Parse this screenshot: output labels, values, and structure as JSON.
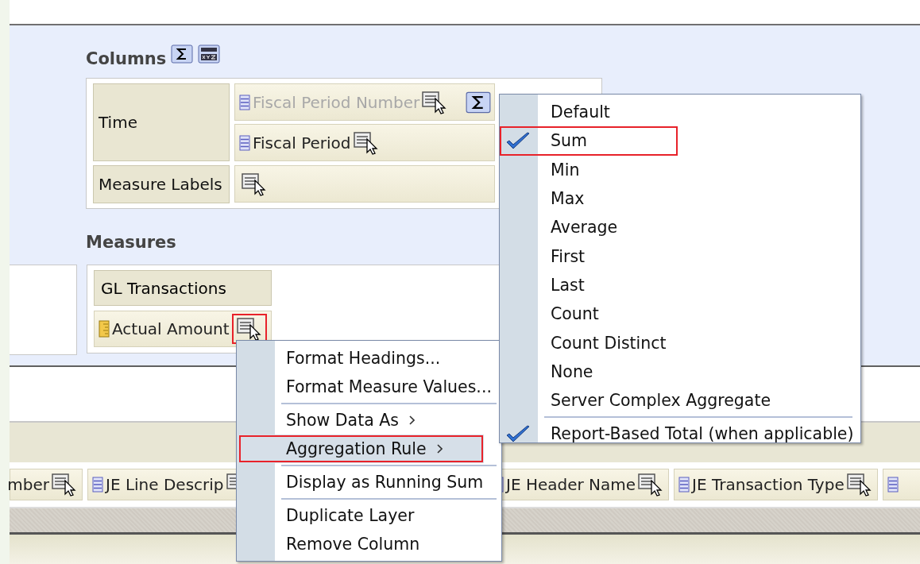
{
  "columns": {
    "title": "Columns",
    "rows": [
      {
        "kind": "hierarchy",
        "label": "Time",
        "items": [
          {
            "label": "Fiscal Period Number",
            "disabled": true,
            "sigma": true
          },
          {
            "label": "Fiscal Period",
            "disabled": false,
            "sigma": false
          }
        ]
      },
      {
        "kind": "measure_labels",
        "label": "Measure Labels"
      }
    ]
  },
  "measures": {
    "title": "Measures",
    "group": "GL Transactions",
    "items": [
      {
        "label": "Actual Amount",
        "highlighted": true
      }
    ]
  },
  "field_bar": [
    {
      "label": "mber"
    },
    {
      "label": "JE Line Descrip",
      "icon": true
    },
    {
      "label": "JE Header Name",
      "icon": true
    },
    {
      "label": "JE Transaction Type",
      "icon": true
    },
    {
      "icon": true
    }
  ],
  "context_menu": [
    {
      "kind": "item",
      "label": "Format Headings...",
      "highlighted": false
    },
    {
      "kind": "item",
      "label": "Format Measure Values...",
      "highlighted": false
    },
    {
      "kind": "separator"
    },
    {
      "kind": "submenu",
      "label": "Show Data As",
      "highlighted": false
    },
    {
      "kind": "submenu",
      "label": "Aggregation Rule",
      "highlighted": true
    },
    {
      "kind": "separator"
    },
    {
      "kind": "item",
      "label": "Display as Running Sum",
      "highlighted": false
    },
    {
      "kind": "separator"
    },
    {
      "kind": "item",
      "label": "Duplicate Layer",
      "highlighted": false
    },
    {
      "kind": "item",
      "label": "Remove Column",
      "highlighted": false
    }
  ],
  "aggregation_menu": [
    {
      "kind": "item",
      "label": "Default",
      "checked": false,
      "highlighted": false
    },
    {
      "kind": "item",
      "label": "Sum",
      "checked": true,
      "highlighted": true
    },
    {
      "kind": "item",
      "label": "Min",
      "checked": false,
      "highlighted": false
    },
    {
      "kind": "item",
      "label": "Max",
      "checked": false,
      "highlighted": false
    },
    {
      "kind": "item",
      "label": "Average",
      "checked": false,
      "highlighted": false
    },
    {
      "kind": "item",
      "label": "First",
      "checked": false,
      "highlighted": false
    },
    {
      "kind": "item",
      "label": "Last",
      "checked": false,
      "highlighted": false
    },
    {
      "kind": "item",
      "label": "Count",
      "checked": false,
      "highlighted": false
    },
    {
      "kind": "item",
      "label": "Count Distinct",
      "checked": false,
      "highlighted": false
    },
    {
      "kind": "item",
      "label": "None",
      "checked": false,
      "highlighted": false
    },
    {
      "kind": "item",
      "label": "Server Complex Aggregate",
      "checked": false,
      "highlighted": false
    },
    {
      "kind": "separator"
    },
    {
      "kind": "item",
      "label": "Report-Based Total (when applicable)",
      "checked": true,
      "highlighted": false
    }
  ]
}
